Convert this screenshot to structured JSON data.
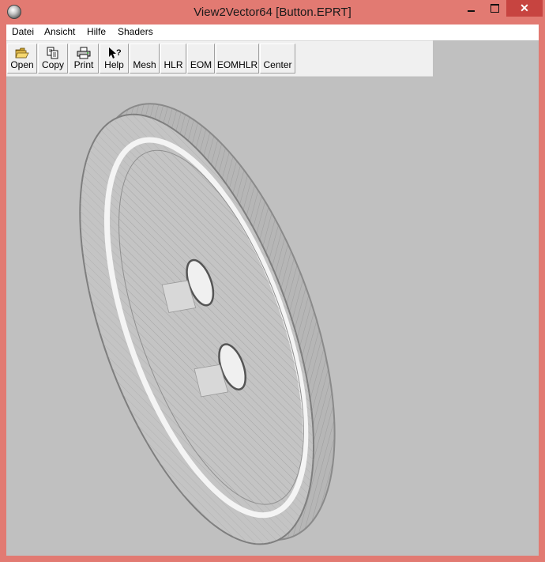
{
  "window": {
    "title": "View2Vector64 [Button.EPRT]"
  },
  "menu": [
    "Datei",
    "Ansicht",
    "Hilfe",
    "Shaders"
  ],
  "toolbar": {
    "open": "Open",
    "copy": "Copy",
    "print": "Print",
    "help": "Help",
    "mesh": "Mesh",
    "hlr": "HLR",
    "eom": "EOM",
    "eomhlr": "EOMHLR",
    "center": "Center"
  },
  "icons": {
    "app": "app-sphere-icon",
    "minimize": "minimize-icon",
    "maximize": "maximize-icon",
    "close": "close-icon",
    "open": "folder-open-icon",
    "copy": "copy-icon",
    "print": "printer-icon",
    "help": "help-cursor-icon"
  },
  "colors": {
    "titlebar": "#e27a72",
    "close_button": "#c74440",
    "viewport": "#c0c0c0",
    "mesh": "#8a8a8a"
  },
  "controls": {
    "close_glyph": "✕"
  }
}
